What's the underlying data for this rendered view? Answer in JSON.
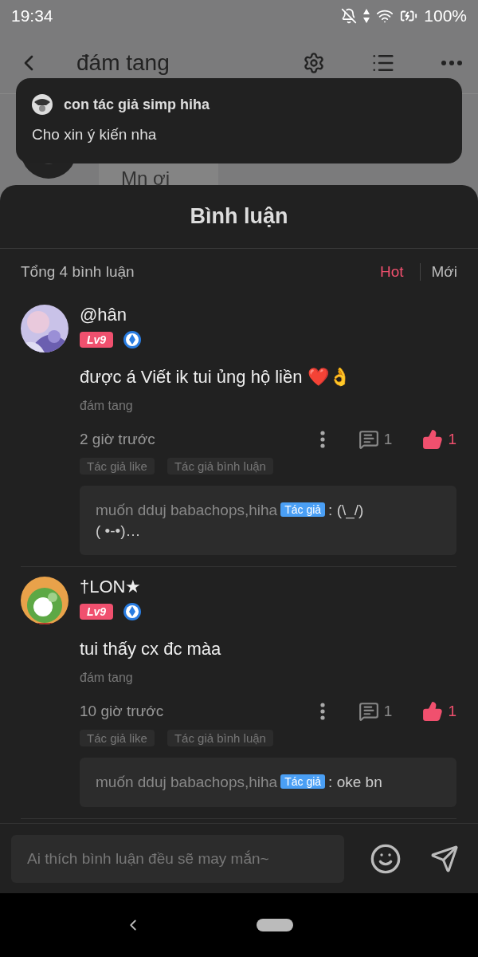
{
  "status_bar": {
    "time": "19:34",
    "battery": "100%"
  },
  "header": {
    "title": "đám tang"
  },
  "background_post": {
    "text": "Mn ơi"
  },
  "notification": {
    "author": "con tác giả simp hiha",
    "message": "Cho xin ý kiến nha"
  },
  "sheet": {
    "title": "Bình luận",
    "total": "Tổng 4 bình luận",
    "sort_tabs": [
      {
        "label": "Hot",
        "selected": true
      },
      {
        "label": "Mới",
        "selected": false
      }
    ]
  },
  "comments": [
    {
      "name": "@hân",
      "level": "Lv9",
      "text": "được á Viết ik tui ủng hộ liền ❤️👌",
      "story": "đám tang",
      "time": "2 giờ trước",
      "replies": "1",
      "likes": "1",
      "liked": true,
      "tags": [
        "Tác giả like",
        "Tác giả bình luận"
      ],
      "reply": {
        "author": "muốn dduj babachops,hiha",
        "badge": "Tác giả",
        "text": ": (\\_/)\n( •-•)…"
      }
    },
    {
      "name": "†LON★",
      "level": "Lv9",
      "text": "tui thấy cx đc màa",
      "story": "đám tang",
      "time": "10 giờ trước",
      "replies": "1",
      "likes": "1",
      "liked": true,
      "tags": [
        "Tác giả like",
        "Tác giả bình luận"
      ],
      "reply": {
        "author": "muốn dduj babachops,hiha",
        "badge": "Tác giả",
        "text": ": oke bn"
      }
    }
  ],
  "composer": {
    "placeholder": "Ai thích bình luận đều sẽ may mắn~"
  }
}
